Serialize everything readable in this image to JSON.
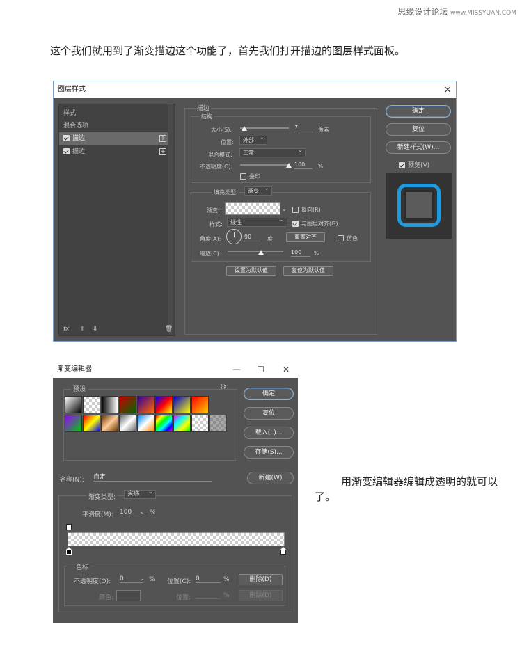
{
  "watermark": {
    "main": "思缘设计论坛",
    "url": "www.MISSYUAN.COM"
  },
  "intro_text": "这个我们就用到了渐变描边这个功能了，首先我们打开描边的图层样式面板。",
  "layer_style": {
    "title": "图层样式",
    "close": "×",
    "left_items": [
      {
        "label": "样式"
      },
      {
        "label": "混合选项"
      },
      {
        "label": "描边",
        "checked": true,
        "selected": true,
        "plus": "+"
      },
      {
        "label": "描边",
        "checked": true,
        "selected": false,
        "plus": "+"
      }
    ],
    "fx_label": "fx",
    "stroke_section": "描边",
    "structure": "结构",
    "size_label": "大小(S):",
    "size_value": "7",
    "size_unit": "像素",
    "position_label": "位置:",
    "position_value": "外部",
    "blend_label": "混合模式:",
    "blend_value": "正常",
    "opacity_label": "不透明度(O):",
    "opacity_value": "100",
    "opacity_unit": "%",
    "overprint_label": "叠印",
    "fill_type_label": "填充类型:",
    "fill_type_value": "渐变",
    "gradient_label": "渐变:",
    "reverse_label": "反向(R)",
    "style_label": "样式:",
    "style_value": "线性",
    "align_label": "与图层对齐(G)",
    "angle_label": "角度(A):",
    "angle_value": "90",
    "angle_unit": "度",
    "reset_align": "重置对齐",
    "dither_label": "仿色",
    "scale_label": "缩放(C):",
    "scale_value": "100",
    "scale_unit": "%",
    "set_default": "设置为默认值",
    "reset_default": "复位为默认值",
    "ok": "确定",
    "reset": "复位",
    "new_style": "新建样式(W)...",
    "preview_label": "预览(V)"
  },
  "gradient_editor": {
    "title": "渐变编辑器",
    "minimize": "—",
    "maximize": "☐",
    "close": "✕",
    "presets_label": "预设",
    "gear": "⚙",
    "ok": "确定",
    "reset": "复位",
    "load": "载入(L)...",
    "save": "存储(S)...",
    "name_label": "名称(N):",
    "name_value": "自定",
    "new_btn": "新建(W)",
    "grad_type_label": "渐变类型:",
    "grad_type_value": "实底",
    "smooth_label": "平滑度(M):",
    "smooth_value": "100",
    "smooth_unit": "%",
    "stops_label": "色标",
    "stop_opacity_label": "不透明度(O):",
    "stop_opacity_value": "0",
    "stop_opacity_unit": "%",
    "stop_pos_label": "位置(C):",
    "stop_pos_value": "0",
    "stop_pos_unit": "%",
    "delete_btn": "删除(D)",
    "color_label": "颜色:",
    "color_pos_label": "位置:",
    "color_pos_unit": "%",
    "color_delete_btn": "删除(D)"
  },
  "caption": "用渐变编辑器编辑成透明的就可以了。"
}
